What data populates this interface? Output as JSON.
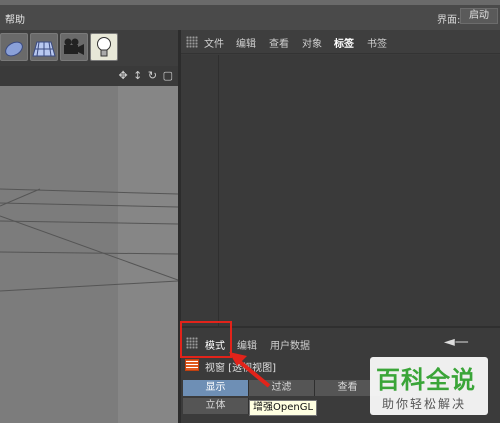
{
  "menubar": {
    "help": "帮助",
    "layout_label": "界面:",
    "layout_value": "启动"
  },
  "toolbar": {
    "tools": [
      "deformer-icon",
      "floor-icon",
      "camera-icon",
      "light-icon"
    ]
  },
  "object_manager": {
    "menus": [
      "文件",
      "编辑",
      "查看",
      "对象",
      "标签",
      "书签"
    ],
    "active_menu": "标签"
  },
  "attribute_manager": {
    "menus": [
      "模式",
      "编辑",
      "用户数据"
    ],
    "title": "视窗 [透视视图]",
    "tabs_row1": [
      "显示",
      "过滤",
      "查看"
    ],
    "tabs_row2": [
      "立体",
      "增强OpenGL"
    ],
    "tooltip": "增强OpenGL"
  },
  "watermark": {
    "title": "百科全说",
    "subtitle": "助你轻松解决"
  },
  "colors": {
    "accent": "#e2231a",
    "tab_selected": "#6e8fb5",
    "watermark_green": "#3aa538"
  }
}
